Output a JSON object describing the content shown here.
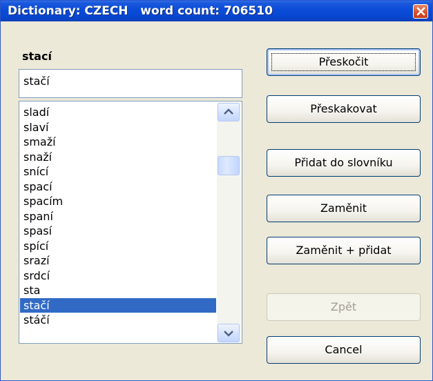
{
  "window": {
    "title": "Dictionary: CZECH   word count: 706510"
  },
  "word": {
    "label": "stací",
    "value": "stačí"
  },
  "suggestions": [
    "sladí",
    "slaví",
    "smaží",
    "snaží",
    "snící",
    "spací",
    "spacím",
    "spaní",
    "spasí",
    "spící",
    "srazí",
    "srdcí",
    "sta",
    "stačí",
    "stáčí"
  ],
  "selected_suggestion": "stačí",
  "buttons": {
    "skip": "Přeskočit",
    "skip_all": "Přeskakovat",
    "add": "Přidat do slovníku",
    "replace": "Zaměnit",
    "replace_add": "Zaměnit + přidat",
    "undo": "Zpět",
    "cancel": "Cancel"
  },
  "colors": {
    "titlebar": "#0846cf",
    "selection": "#316ac5",
    "close": "#d4502c"
  },
  "icons": {
    "close": "close-icon",
    "scroll_up": "chevron-up-icon",
    "scroll_down": "chevron-down-icon"
  }
}
